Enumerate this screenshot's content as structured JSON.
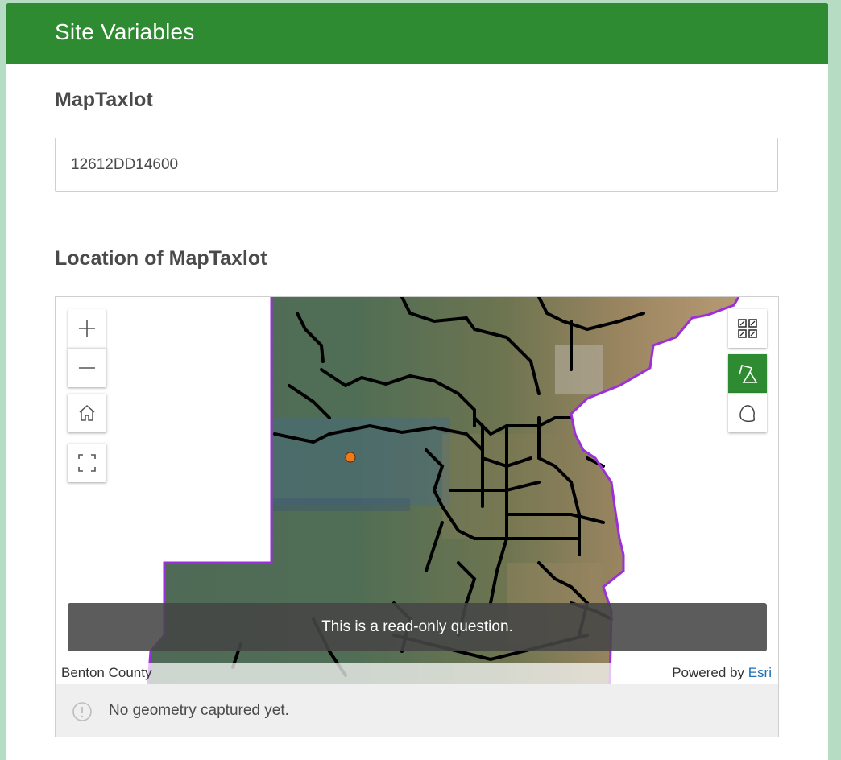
{
  "header": {
    "title": "Site Variables"
  },
  "questions": [
    {
      "label": "MapTaxlot",
      "value": "12612DD14600"
    },
    {
      "label": "Location of MapTaxlot"
    }
  ],
  "map": {
    "controls": [
      "zoom-in-icon",
      "zoom-out-icon",
      "home-icon",
      "fullscreen-icon"
    ],
    "tools": [
      "basemap-gallery-icon",
      "shape-draw-icon",
      "freehand-draw-icon"
    ],
    "readonly_message": "This is a read-only question.",
    "attribution_left": "Benton County",
    "powered_by": "Powered by",
    "powered_by_link": "Esri",
    "status": "No geometry captured yet.",
    "colors": {
      "boundary": "#9b30d9",
      "roads": "#000000",
      "marker": "#f07a1a",
      "accent": "#2e8b31"
    }
  }
}
